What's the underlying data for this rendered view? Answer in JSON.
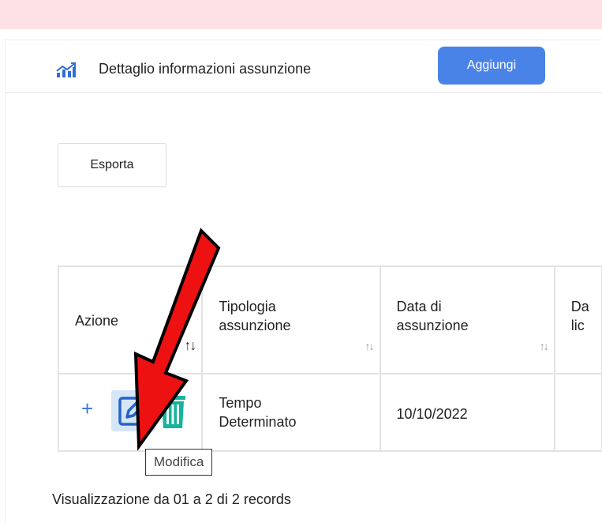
{
  "header": {
    "title": "Dettaglio informazioni assunzione",
    "add_button": "Aggiungi",
    "icon": "chart-line-icon"
  },
  "toolbar": {
    "export_button": "Esporta"
  },
  "table": {
    "columns": [
      {
        "label_line1": "Azione",
        "label_line2": ""
      },
      {
        "label_line1": "Tipologia",
        "label_line2": "assunzione"
      },
      {
        "label_line1": "Data di",
        "label_line2": "assunzione"
      },
      {
        "label_line1": "Da",
        "label_line2": "lic"
      }
    ],
    "rows": [
      {
        "tipologia_line1": "Tempo",
        "tipologia_line2": "Determinato",
        "data_assunzione": "10/10/2022",
        "actions": [
          "plus-icon",
          "edit-icon",
          "trash-icon"
        ]
      }
    ]
  },
  "tooltip": {
    "text": "Modifica"
  },
  "footer": {
    "records_text": "Visualizzazione da 01 a 2 di 2 records"
  },
  "colors": {
    "banner": "#fde1e4",
    "accent": "#4a83e8",
    "trash": "#17b39a",
    "arrow": "#ee1111"
  }
}
